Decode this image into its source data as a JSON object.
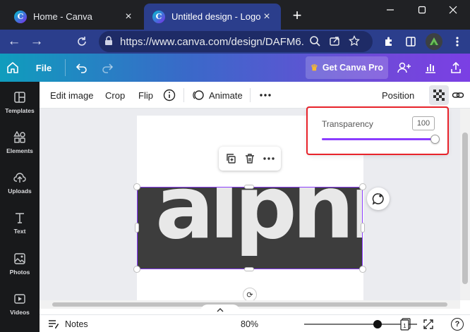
{
  "browser": {
    "tabs": [
      {
        "title": "Home - Canva",
        "favicon": "canva-logo-icon"
      },
      {
        "title": "Untitled design - Logo",
        "favicon": "canva-logo-icon"
      }
    ],
    "favicon_letter": "C",
    "url": "https://www.canva.com/design/DAFM6..."
  },
  "canva_bar": {
    "file_label": "File",
    "get_pro_label": "Get Canva Pro"
  },
  "sidebar": {
    "items": [
      {
        "label": "Templates",
        "icon": "templates-icon"
      },
      {
        "label": "Elements",
        "icon": "elements-icon"
      },
      {
        "label": "Uploads",
        "icon": "uploads-icon"
      },
      {
        "label": "Text",
        "icon": "text-icon"
      },
      {
        "label": "Photos",
        "icon": "photos-icon"
      },
      {
        "label": "Videos",
        "icon": "videos-icon"
      }
    ]
  },
  "toolbar": {
    "edit_image": "Edit image",
    "crop": "Crop",
    "flip": "Flip",
    "animate": "Animate",
    "position": "Position"
  },
  "canvas": {
    "wordmark": "alphr"
  },
  "transparency": {
    "label": "Transparency",
    "value": "100",
    "fraction": 1.0
  },
  "footer": {
    "notes_label": "Notes",
    "zoom_label": "80%",
    "zoom_fraction": 0.65,
    "page_count": "1",
    "help_label": "?"
  },
  "colors": {
    "accent": "#8b3dff",
    "highlight": "#e8232b",
    "sidebar_bg": "#18191b",
    "browser_active": "#2b3e8c"
  }
}
